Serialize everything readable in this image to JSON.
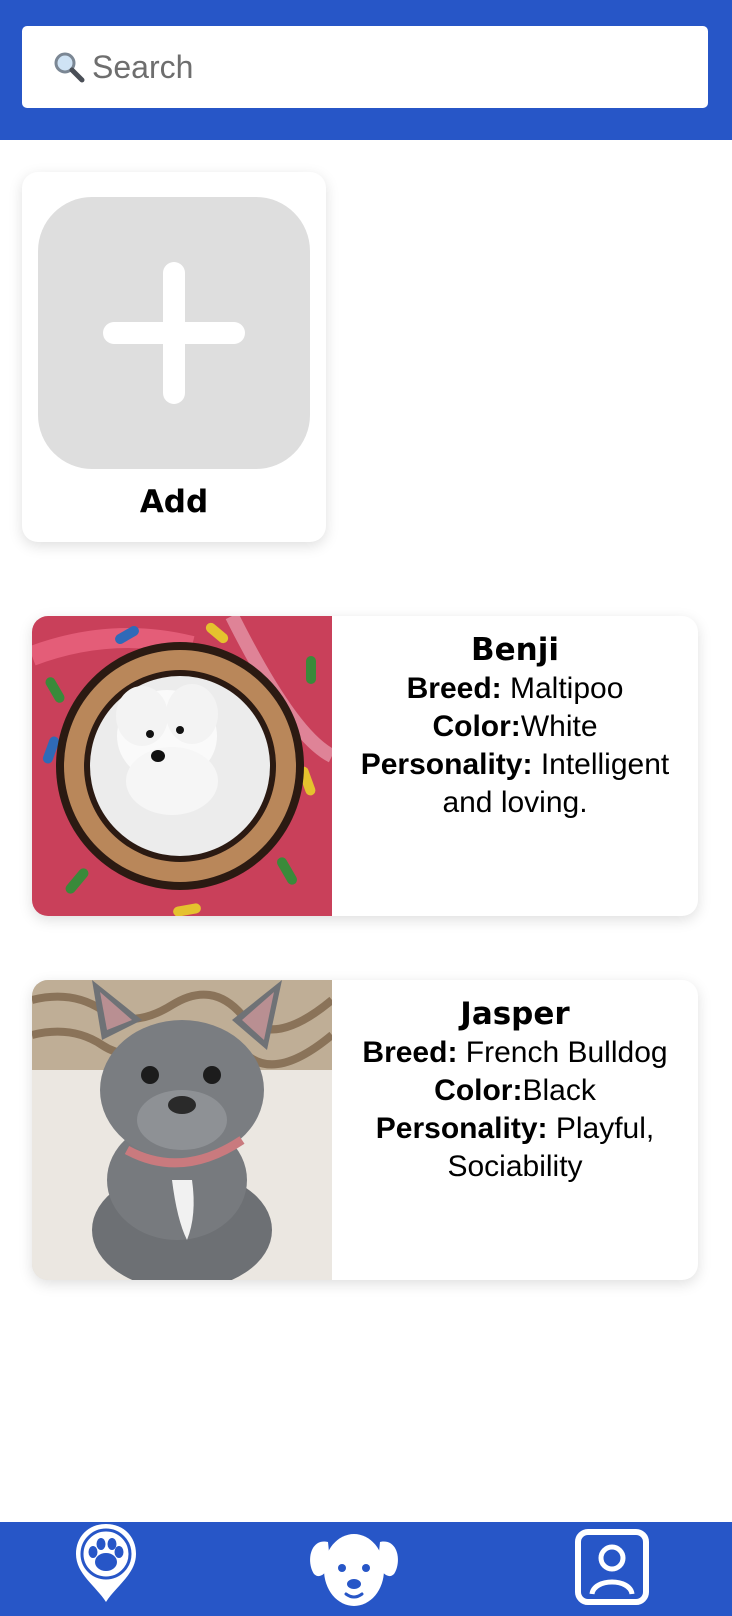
{
  "search": {
    "placeholder": "Search",
    "icon": "search-icon"
  },
  "add_card": {
    "label": "Add",
    "icon": "plus-icon"
  },
  "labels": {
    "breed": "Breed:",
    "color": "Color:",
    "personality": "Personality:"
  },
  "pets": [
    {
      "name": "Benji",
      "breed": "Maltipoo",
      "color": "White",
      "personality": "Intelligent and loving."
    },
    {
      "name": "Jasper",
      "breed": "French Bulldog",
      "color": "Black",
      "personality": "Playful, Sociability"
    }
  ],
  "bottom_nav": {
    "items": [
      {
        "icon": "paw-location-icon"
      },
      {
        "icon": "dog-face-icon"
      },
      {
        "icon": "profile-icon"
      }
    ]
  },
  "colors": {
    "brand_blue": "#2756c7",
    "tile_gray": "#dedede"
  }
}
